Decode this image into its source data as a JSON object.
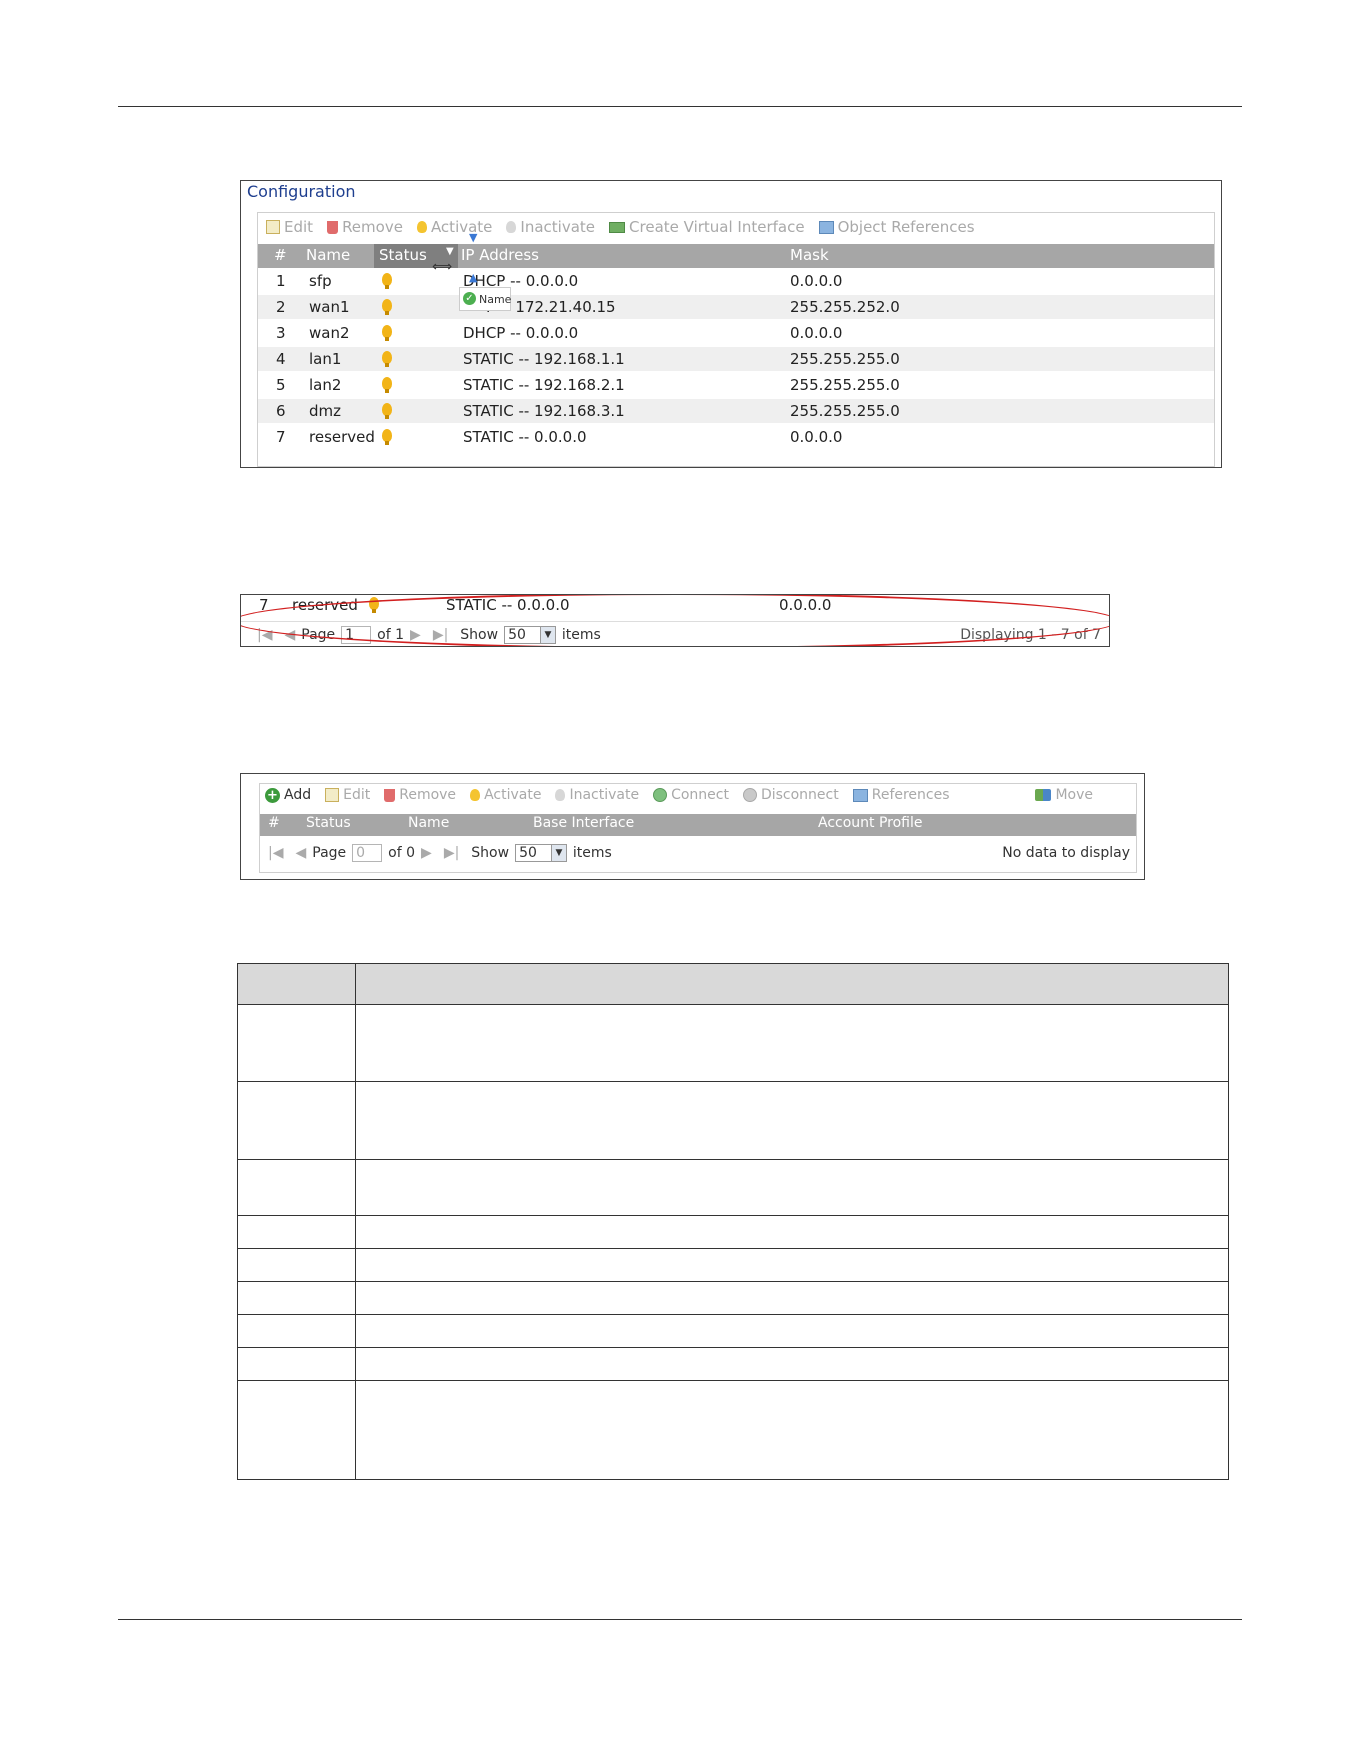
{
  "config_panel": {
    "title": "Configuration",
    "toolbar": [
      "Edit",
      "Remove",
      "Activate",
      "Inactivate",
      "Create Virtual Interface",
      "Object References"
    ],
    "columns": [
      "#",
      "Name",
      "Status",
      "IP Address",
      "Mask"
    ],
    "rows": [
      {
        "num": "1",
        "name": "sfp",
        "ip": "DHCP -- 0.0.0.0",
        "mask": "0.0.0.0"
      },
      {
        "num": "2",
        "name": "wan1",
        "ip": "P -- 172.21.40.15",
        "mask": "255.255.252.0"
      },
      {
        "num": "3",
        "name": "wan2",
        "ip": "DHCP -- 0.0.0.0",
        "mask": "0.0.0.0"
      },
      {
        "num": "4",
        "name": "lan1",
        "ip": "STATIC -- 192.168.1.1",
        "mask": "255.255.255.0"
      },
      {
        "num": "5",
        "name": "lan2",
        "ip": "STATIC -- 192.168.2.1",
        "mask": "255.255.255.0"
      },
      {
        "num": "6",
        "name": "dmz",
        "ip": "STATIC -- 192.168.3.1",
        "mask": "255.255.255.0"
      },
      {
        "num": "7",
        "name": "reserved",
        "ip": "STATIC -- 0.0.0.0",
        "mask": "0.0.0.0"
      }
    ],
    "drag_tooltip": "Name"
  },
  "pager_panel": {
    "row": {
      "num": "7",
      "name": "reserved",
      "ip": "STATIC -- 0.0.0.0",
      "mask": "0.0.0.0"
    },
    "page_label": "Page",
    "page_value": "1",
    "of_label": "of 1",
    "show_label": "Show",
    "show_value": "50",
    "items_label": "items",
    "displaying": "Displaying 1 - 7 of 7"
  },
  "vlan_panel": {
    "toolbar": [
      "Add",
      "Edit",
      "Remove",
      "Activate",
      "Inactivate",
      "Connect",
      "Disconnect",
      "References",
      "Move"
    ],
    "columns": [
      "#",
      "Status",
      "Name",
      "Base Interface",
      "Account Profile"
    ],
    "page_label": "Page",
    "page_value": "0",
    "of_label": "of 0",
    "show_label": "Show",
    "show_value": "50",
    "items_label": "items",
    "no_data": "No data to display"
  }
}
